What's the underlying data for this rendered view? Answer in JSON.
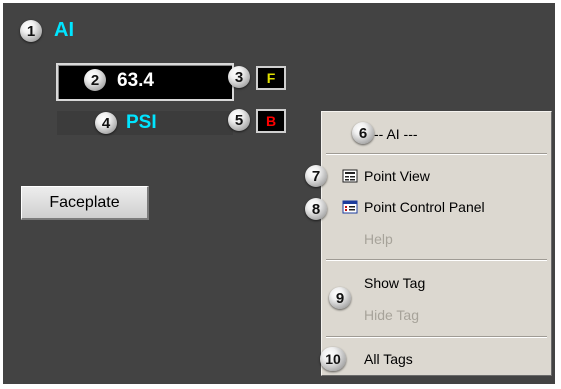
{
  "faceplate": {
    "point_name": "AI",
    "value": "63.4",
    "units": "PSI",
    "flag_f": "F",
    "flag_b": "B",
    "button_label": "Faceplate"
  },
  "context_menu": {
    "header": "-- AI ---",
    "items": [
      {
        "label": "Point View",
        "icon": "point-view-icon",
        "enabled": true
      },
      {
        "label": "Point Control Panel",
        "icon": "control-panel-icon",
        "enabled": true
      },
      {
        "label": "Help",
        "enabled": false
      },
      {
        "label": "Show Tag",
        "enabled": true
      },
      {
        "label": "Hide Tag",
        "enabled": false
      },
      {
        "label": "All Tags",
        "enabled": true
      }
    ]
  },
  "callouts": [
    "1",
    "2",
    "3",
    "4",
    "5",
    "6",
    "7",
    "8",
    "9",
    "10"
  ],
  "colors": {
    "background": "#434343",
    "accent_cyan": "#00e5ff",
    "flag_f": "#e0e000",
    "flag_b": "#ff0000",
    "menu_bg": "#dcd8d0"
  }
}
